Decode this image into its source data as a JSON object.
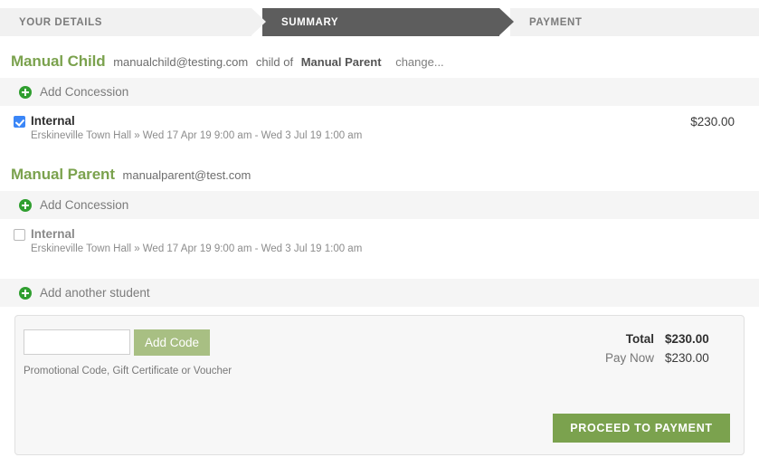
{
  "steps": [
    {
      "label": "YOUR DETAILS",
      "active": false
    },
    {
      "label": "SUMMARY",
      "active": true
    },
    {
      "label": "PAYMENT",
      "active": false
    }
  ],
  "students": [
    {
      "name": "Manual Child",
      "email": "manualchild@testing.com",
      "relation_text": "child of",
      "parent_name": "Manual Parent",
      "change_label": "change...",
      "add_concession_label": "Add Concession",
      "course": {
        "title": "Internal",
        "details": "Erskineville Town Hall » Wed 17 Apr 19 9:00 am - Wed 3 Jul 19 1:00 am",
        "price": "$230.00",
        "checked": true
      }
    },
    {
      "name": "Manual Parent",
      "email": "manualparent@test.com",
      "relation_text": "",
      "parent_name": "",
      "change_label": "",
      "add_concession_label": "Add Concession",
      "course": {
        "title": "Internal",
        "details": "Erskineville Town Hall » Wed 17 Apr 19 9:00 am - Wed 3 Jul 19 1:00 am",
        "price": "",
        "checked": false
      }
    }
  ],
  "add_student_label": "Add another student",
  "summary": {
    "code_value": "",
    "code_placeholder": "",
    "add_code_label": "Add Code",
    "code_hint": "Promotional Code, Gift Certificate or Voucher",
    "total_label": "Total",
    "total_value": "$230.00",
    "pay_now_label": "Pay Now",
    "pay_now_value": "$230.00",
    "proceed_label": "PROCEED TO PAYMENT"
  },
  "colors": {
    "brand_green": "#7ba24e",
    "button_green_light": "#a8bf83",
    "plus_green": "#2f9e2f",
    "active_step": "#5d5d5d",
    "inactive_step": "#f1f1f1",
    "checkbox_blue": "#3b86f7",
    "band_grey": "#f5f5f5",
    "panel_grey": "#f7f7f7"
  }
}
